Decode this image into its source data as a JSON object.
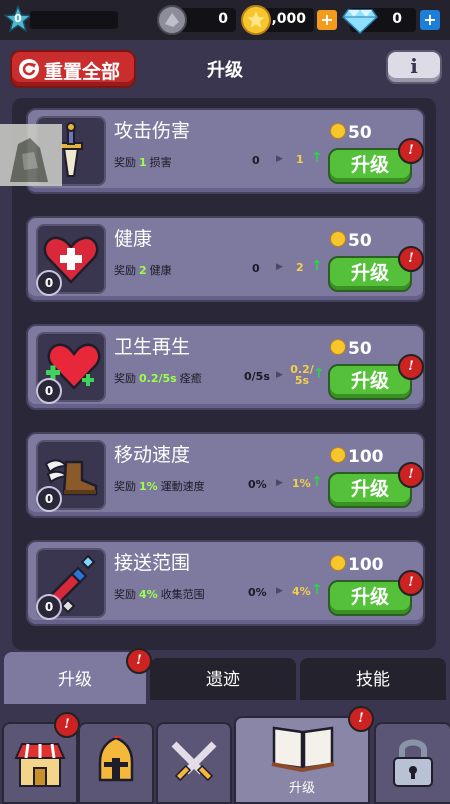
{
  "topbar": {
    "level": "0",
    "gems_stones": "0",
    "gold": "1,000",
    "diamonds": "0",
    "plus": "+"
  },
  "header": {
    "reset_label": "重置全部",
    "title": "升级",
    "info_label": "i"
  },
  "reward_prefix": "奖励",
  "upgrade_label": "升级",
  "alert_glyph": "!",
  "cards": [
    {
      "name": "攻击伤害",
      "reward_value": "1",
      "reward_stat": "损害",
      "from": "0",
      "to": "1",
      "cost": "50",
      "icon": "sword-icon"
    },
    {
      "name": "健康",
      "reward_value": "2",
      "reward_stat": "健康",
      "from": "0",
      "to": "2",
      "cost": "50",
      "icon": "heart-plus-icon",
      "level": "0"
    },
    {
      "name": "卫生再生",
      "reward_value": "0.2/5s",
      "reward_stat": "痊癒",
      "from": "0/5s",
      "to": "0.2/\n5s",
      "cost": "50",
      "icon": "heart-regen-icon",
      "level": "0"
    },
    {
      "name": "移动速度",
      "reward_value": "1%",
      "reward_stat": "運動速度",
      "from": "0%",
      "to": "1%",
      "cost": "100",
      "icon": "winged-boot-icon",
      "level": "0"
    },
    {
      "name": "接送范围",
      "reward_value": "4%",
      "reward_stat": "收集范围",
      "from": "0%",
      "to": "4%",
      "cost": "100",
      "icon": "magnet-icon",
      "level": "0"
    }
  ],
  "tabs": [
    {
      "label": "升级"
    },
    {
      "label": "遗迹"
    },
    {
      "label": "技能"
    }
  ],
  "nav": {
    "active_label": "升级"
  },
  "colors": {
    "accent_green": "#55c13b",
    "reset_red": "#c92d2d",
    "reward_green": "#9cff4a",
    "to_yellow": "#f2d04a"
  }
}
